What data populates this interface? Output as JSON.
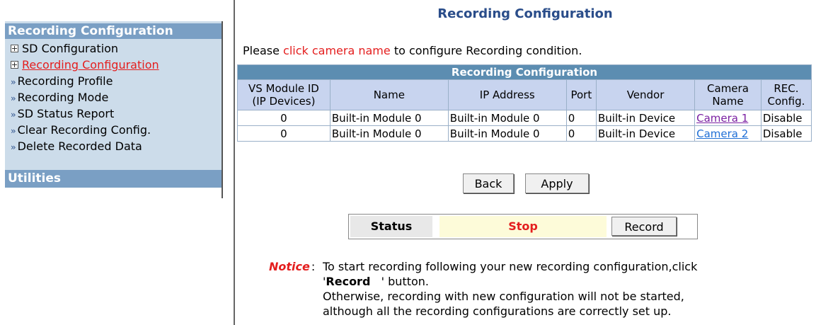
{
  "sidebar": {
    "section_title": "Recording Configuration",
    "items": [
      {
        "label": "SD Configuration",
        "marker": "plus-box"
      },
      {
        "label": "Recording Configuration",
        "marker": "plus-box",
        "active": true
      },
      {
        "label": "Recording Profile",
        "marker": "double-arrow"
      },
      {
        "label": "Recording Mode",
        "marker": "double-arrow"
      },
      {
        "label": "SD Status Report",
        "marker": "double-arrow"
      },
      {
        "label": "Clear Recording Config.",
        "marker": "double-arrow"
      },
      {
        "label": "Delete Recorded Data",
        "marker": "double-arrow"
      }
    ],
    "utilities_title": "Utilities"
  },
  "page_title": "Recording Configuration",
  "instruction": {
    "prefix": "Please ",
    "highlight": "click camera name",
    "suffix": " to configure Recording condition."
  },
  "table": {
    "caption": "Recording Configuration",
    "headers": {
      "vs_module_line1": "VS Module ID",
      "vs_module_line2": "(IP Devices)",
      "name": "Name",
      "ip": "IP Address",
      "port": "Port",
      "vendor": "Vendor",
      "camera_line1": "Camera",
      "camera_line2": "Name",
      "rec_line1": "REC.",
      "rec_line2": "Config."
    },
    "rows": [
      {
        "id": "0",
        "name": "Built-in Module 0",
        "ip": "Built-in Module 0",
        "port": "0",
        "vendor": "Built-in Device",
        "camera": "Camera 1",
        "rec": "Disable"
      },
      {
        "id": "0",
        "name": "Built-in Module 0",
        "ip": "Built-in Module 0",
        "port": "0",
        "vendor": "Built-in Device",
        "camera": "Camera 2",
        "rec": "Disable"
      }
    ]
  },
  "buttons": {
    "back": "Back",
    "apply": "Apply",
    "record": "Record"
  },
  "status": {
    "label": "Status",
    "value": "Stop"
  },
  "notice": {
    "label": "Notice",
    "colon": ":",
    "line1": "To start recording following your new recording configuration,click",
    "line2_open": "'",
    "line2_bold": "Record",
    "line2_close": "   ' button.",
    "line3": "Otherwise, recording with new configuration will not be started,",
    "line4": "although all the recording configurations are correctly set up."
  },
  "colors": {
    "sidebar_bg": "#ccdcea",
    "sidebar_header": "#7a9fc4",
    "table_caption": "#5c8db1",
    "table_header": "#c8d4ef",
    "title_blue": "#2a4d8a",
    "accent_red": "#e41e1e",
    "status_bg": "#fdfbd9"
  }
}
